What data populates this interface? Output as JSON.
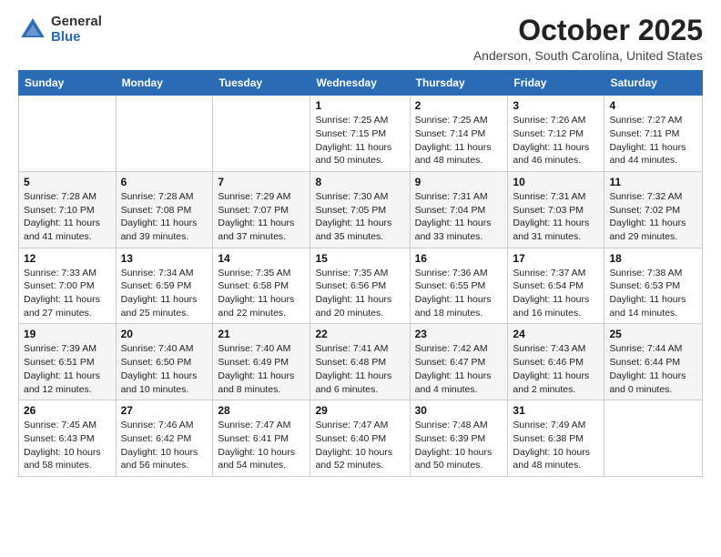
{
  "header": {
    "logo_general": "General",
    "logo_blue": "Blue",
    "month_title": "October 2025",
    "location": "Anderson, South Carolina, United States"
  },
  "days_of_week": [
    "Sunday",
    "Monday",
    "Tuesday",
    "Wednesday",
    "Thursday",
    "Friday",
    "Saturday"
  ],
  "weeks": [
    [
      {
        "day": "",
        "sunrise": "",
        "sunset": "",
        "daylight": ""
      },
      {
        "day": "",
        "sunrise": "",
        "sunset": "",
        "daylight": ""
      },
      {
        "day": "",
        "sunrise": "",
        "sunset": "",
        "daylight": ""
      },
      {
        "day": "1",
        "sunrise": "Sunrise: 7:25 AM",
        "sunset": "Sunset: 7:15 PM",
        "daylight": "Daylight: 11 hours and 50 minutes."
      },
      {
        "day": "2",
        "sunrise": "Sunrise: 7:25 AM",
        "sunset": "Sunset: 7:14 PM",
        "daylight": "Daylight: 11 hours and 48 minutes."
      },
      {
        "day": "3",
        "sunrise": "Sunrise: 7:26 AM",
        "sunset": "Sunset: 7:12 PM",
        "daylight": "Daylight: 11 hours and 46 minutes."
      },
      {
        "day": "4",
        "sunrise": "Sunrise: 7:27 AM",
        "sunset": "Sunset: 7:11 PM",
        "daylight": "Daylight: 11 hours and 44 minutes."
      }
    ],
    [
      {
        "day": "5",
        "sunrise": "Sunrise: 7:28 AM",
        "sunset": "Sunset: 7:10 PM",
        "daylight": "Daylight: 11 hours and 41 minutes."
      },
      {
        "day": "6",
        "sunrise": "Sunrise: 7:28 AM",
        "sunset": "Sunset: 7:08 PM",
        "daylight": "Daylight: 11 hours and 39 minutes."
      },
      {
        "day": "7",
        "sunrise": "Sunrise: 7:29 AM",
        "sunset": "Sunset: 7:07 PM",
        "daylight": "Daylight: 11 hours and 37 minutes."
      },
      {
        "day": "8",
        "sunrise": "Sunrise: 7:30 AM",
        "sunset": "Sunset: 7:05 PM",
        "daylight": "Daylight: 11 hours and 35 minutes."
      },
      {
        "day": "9",
        "sunrise": "Sunrise: 7:31 AM",
        "sunset": "Sunset: 7:04 PM",
        "daylight": "Daylight: 11 hours and 33 minutes."
      },
      {
        "day": "10",
        "sunrise": "Sunrise: 7:31 AM",
        "sunset": "Sunset: 7:03 PM",
        "daylight": "Daylight: 11 hours and 31 minutes."
      },
      {
        "day": "11",
        "sunrise": "Sunrise: 7:32 AM",
        "sunset": "Sunset: 7:02 PM",
        "daylight": "Daylight: 11 hours and 29 minutes."
      }
    ],
    [
      {
        "day": "12",
        "sunrise": "Sunrise: 7:33 AM",
        "sunset": "Sunset: 7:00 PM",
        "daylight": "Daylight: 11 hours and 27 minutes."
      },
      {
        "day": "13",
        "sunrise": "Sunrise: 7:34 AM",
        "sunset": "Sunset: 6:59 PM",
        "daylight": "Daylight: 11 hours and 25 minutes."
      },
      {
        "day": "14",
        "sunrise": "Sunrise: 7:35 AM",
        "sunset": "Sunset: 6:58 PM",
        "daylight": "Daylight: 11 hours and 22 minutes."
      },
      {
        "day": "15",
        "sunrise": "Sunrise: 7:35 AM",
        "sunset": "Sunset: 6:56 PM",
        "daylight": "Daylight: 11 hours and 20 minutes."
      },
      {
        "day": "16",
        "sunrise": "Sunrise: 7:36 AM",
        "sunset": "Sunset: 6:55 PM",
        "daylight": "Daylight: 11 hours and 18 minutes."
      },
      {
        "day": "17",
        "sunrise": "Sunrise: 7:37 AM",
        "sunset": "Sunset: 6:54 PM",
        "daylight": "Daylight: 11 hours and 16 minutes."
      },
      {
        "day": "18",
        "sunrise": "Sunrise: 7:38 AM",
        "sunset": "Sunset: 6:53 PM",
        "daylight": "Daylight: 11 hours and 14 minutes."
      }
    ],
    [
      {
        "day": "19",
        "sunrise": "Sunrise: 7:39 AM",
        "sunset": "Sunset: 6:51 PM",
        "daylight": "Daylight: 11 hours and 12 minutes."
      },
      {
        "day": "20",
        "sunrise": "Sunrise: 7:40 AM",
        "sunset": "Sunset: 6:50 PM",
        "daylight": "Daylight: 11 hours and 10 minutes."
      },
      {
        "day": "21",
        "sunrise": "Sunrise: 7:40 AM",
        "sunset": "Sunset: 6:49 PM",
        "daylight": "Daylight: 11 hours and 8 minutes."
      },
      {
        "day": "22",
        "sunrise": "Sunrise: 7:41 AM",
        "sunset": "Sunset: 6:48 PM",
        "daylight": "Daylight: 11 hours and 6 minutes."
      },
      {
        "day": "23",
        "sunrise": "Sunrise: 7:42 AM",
        "sunset": "Sunset: 6:47 PM",
        "daylight": "Daylight: 11 hours and 4 minutes."
      },
      {
        "day": "24",
        "sunrise": "Sunrise: 7:43 AM",
        "sunset": "Sunset: 6:46 PM",
        "daylight": "Daylight: 11 hours and 2 minutes."
      },
      {
        "day": "25",
        "sunrise": "Sunrise: 7:44 AM",
        "sunset": "Sunset: 6:44 PM",
        "daylight": "Daylight: 11 hours and 0 minutes."
      }
    ],
    [
      {
        "day": "26",
        "sunrise": "Sunrise: 7:45 AM",
        "sunset": "Sunset: 6:43 PM",
        "daylight": "Daylight: 10 hours and 58 minutes."
      },
      {
        "day": "27",
        "sunrise": "Sunrise: 7:46 AM",
        "sunset": "Sunset: 6:42 PM",
        "daylight": "Daylight: 10 hours and 56 minutes."
      },
      {
        "day": "28",
        "sunrise": "Sunrise: 7:47 AM",
        "sunset": "Sunset: 6:41 PM",
        "daylight": "Daylight: 10 hours and 54 minutes."
      },
      {
        "day": "29",
        "sunrise": "Sunrise: 7:47 AM",
        "sunset": "Sunset: 6:40 PM",
        "daylight": "Daylight: 10 hours and 52 minutes."
      },
      {
        "day": "30",
        "sunrise": "Sunrise: 7:48 AM",
        "sunset": "Sunset: 6:39 PM",
        "daylight": "Daylight: 10 hours and 50 minutes."
      },
      {
        "day": "31",
        "sunrise": "Sunrise: 7:49 AM",
        "sunset": "Sunset: 6:38 PM",
        "daylight": "Daylight: 10 hours and 48 minutes."
      },
      {
        "day": "",
        "sunrise": "",
        "sunset": "",
        "daylight": ""
      }
    ]
  ]
}
